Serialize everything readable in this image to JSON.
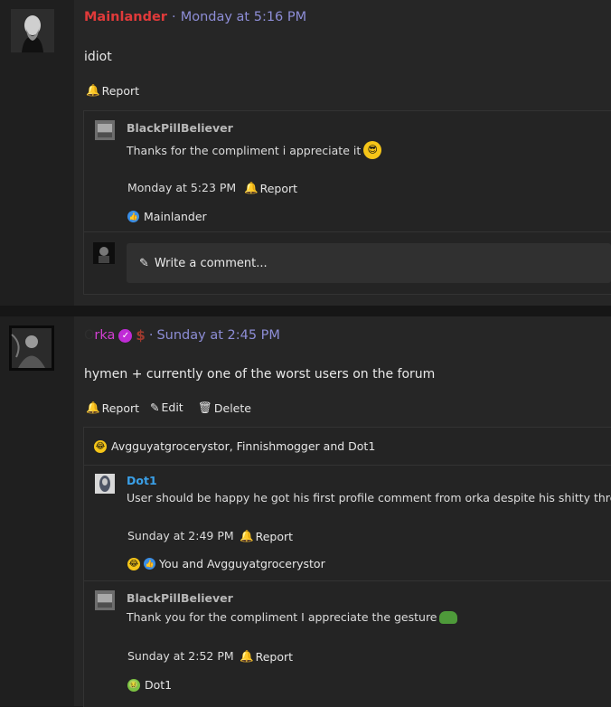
{
  "post1": {
    "author": "Mainlander",
    "author_color": "#e03a3a",
    "separator": "·",
    "time": "Monday at 5:16 PM",
    "body": "idiot",
    "actions": {
      "report": "Report"
    },
    "reply": {
      "author": "BlackPillBeliever",
      "body": "Thanks for the compliment i appreciate it",
      "time": "Monday at 5:23 PM",
      "report": "Report",
      "reaction_users": "Mainlander"
    },
    "comment_placeholder": "Write a comment..."
  },
  "post2": {
    "author_prefix": "O",
    "author_rest": "rka",
    "author_color": "#d23fd2",
    "separator": "·",
    "time": "Sunday at 2:45 PM",
    "body": "hymen + currently one of the worst users on the forum",
    "actions": {
      "report": "Report",
      "edit": "Edit",
      "delete": "Delete"
    },
    "reactions_summary": "Avgguyatgrocerystor, Finnishmogger and Dot1",
    "replies": [
      {
        "author": "Dot1",
        "author_color": "#3aa0e8",
        "body": "User should be happy he got his first profile comment from orka despite his shitty threads",
        "time": "Sunday at 2:49 PM",
        "report": "Report",
        "reaction_users": "You and Avgguyatgrocerystor"
      },
      {
        "author": "BlackPillBeliever",
        "author_color": "#b8b8b8",
        "body": "Thank you for the compliment I appreciate the gesture",
        "time": "Sunday at 2:52 PM",
        "report": "Report",
        "reaction_users": "Dot1"
      }
    ]
  }
}
